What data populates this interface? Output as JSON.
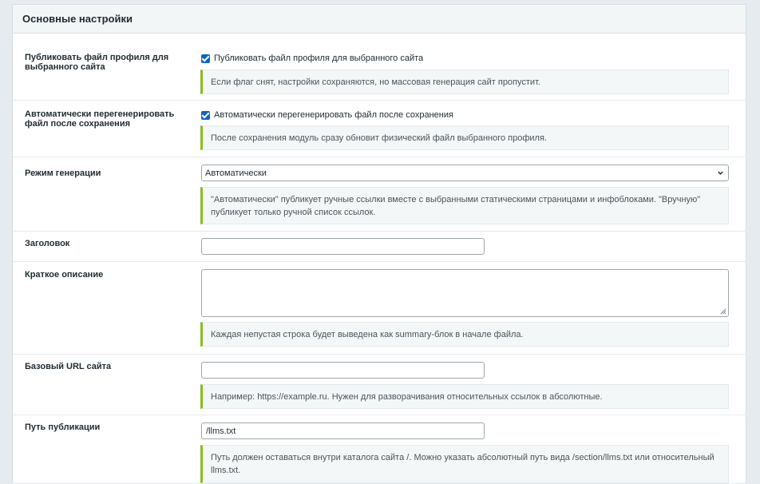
{
  "panel": {
    "title": "Основные настройки"
  },
  "rows": {
    "publish": {
      "label": "Публиковать файл профиля для выбранного сайта",
      "checkbox_label": "Публиковать файл профиля для выбранного сайта",
      "checked": true,
      "hint": "Если флаг снят, настройки сохраняются, но массовая генерация сайт пропустит."
    },
    "regenerate": {
      "label": "Автоматически перегенерировать файл после сохранения",
      "checkbox_label": "Автоматически перегенерировать файл после сохранения",
      "checked": true,
      "hint": "После сохранения модуль сразу обновит физический файл выбранного профиля."
    },
    "mode": {
      "label": "Режим генерации",
      "selected": "Автоматически",
      "hint": "\"Автоматически\" публикует ручные ссылки вместе с выбранными статическими страницами и инфоблоками. \"Вручную\" публикует только ручной список ссылок."
    },
    "title": {
      "label": "Заголовок",
      "value": ""
    },
    "description": {
      "label": "Краткое описание",
      "value": "",
      "hint": "Каждая непустая строка будет выведена как summary-блок в начале файла."
    },
    "base_url": {
      "label": "Базовый URL сайта",
      "value": "",
      "hint": "Например: https://example.ru. Нужен для разворачивания относительных ссылок в абсолютные."
    },
    "path": {
      "label": "Путь публикации",
      "value": "/llms.txt",
      "hint": "Путь должен оставаться внутри каталога сайта /. Можно указать абсолютный путь вида /section/llms.txt или относительный llms.txt."
    }
  },
  "colors": {
    "accent_checkbox": "#0b65c5",
    "hint_border": "#8dba1f",
    "hint_bg": "#f4f7f8",
    "page_bg": "#e5ebee"
  },
  "icons": {
    "checkbox": "checkmark-icon",
    "select": "chevron-down-icon",
    "textarea": "resize-grip-icon"
  }
}
